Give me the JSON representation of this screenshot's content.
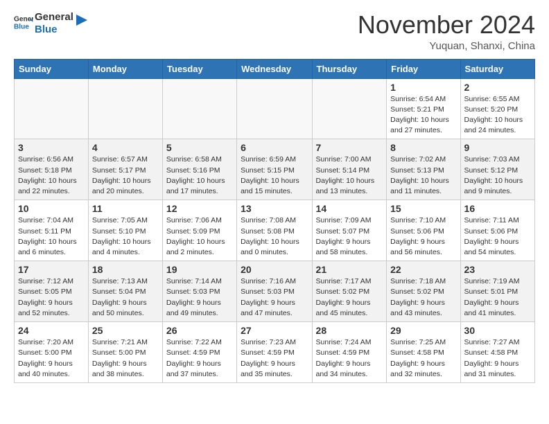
{
  "header": {
    "logo_general": "General",
    "logo_blue": "Blue",
    "month_title": "November 2024",
    "location": "Yuquan, Shanxi, China"
  },
  "weekdays": [
    "Sunday",
    "Monday",
    "Tuesday",
    "Wednesday",
    "Thursday",
    "Friday",
    "Saturday"
  ],
  "weeks": [
    {
      "shaded": false,
      "days": [
        {
          "num": "",
          "info": ""
        },
        {
          "num": "",
          "info": ""
        },
        {
          "num": "",
          "info": ""
        },
        {
          "num": "",
          "info": ""
        },
        {
          "num": "",
          "info": ""
        },
        {
          "num": "1",
          "info": "Sunrise: 6:54 AM\nSunset: 5:21 PM\nDaylight: 10 hours\nand 27 minutes."
        },
        {
          "num": "2",
          "info": "Sunrise: 6:55 AM\nSunset: 5:20 PM\nDaylight: 10 hours\nand 24 minutes."
        }
      ]
    },
    {
      "shaded": true,
      "days": [
        {
          "num": "3",
          "info": "Sunrise: 6:56 AM\nSunset: 5:18 PM\nDaylight: 10 hours\nand 22 minutes."
        },
        {
          "num": "4",
          "info": "Sunrise: 6:57 AM\nSunset: 5:17 PM\nDaylight: 10 hours\nand 20 minutes."
        },
        {
          "num": "5",
          "info": "Sunrise: 6:58 AM\nSunset: 5:16 PM\nDaylight: 10 hours\nand 17 minutes."
        },
        {
          "num": "6",
          "info": "Sunrise: 6:59 AM\nSunset: 5:15 PM\nDaylight: 10 hours\nand 15 minutes."
        },
        {
          "num": "7",
          "info": "Sunrise: 7:00 AM\nSunset: 5:14 PM\nDaylight: 10 hours\nand 13 minutes."
        },
        {
          "num": "8",
          "info": "Sunrise: 7:02 AM\nSunset: 5:13 PM\nDaylight: 10 hours\nand 11 minutes."
        },
        {
          "num": "9",
          "info": "Sunrise: 7:03 AM\nSunset: 5:12 PM\nDaylight: 10 hours\nand 9 minutes."
        }
      ]
    },
    {
      "shaded": false,
      "days": [
        {
          "num": "10",
          "info": "Sunrise: 7:04 AM\nSunset: 5:11 PM\nDaylight: 10 hours\nand 6 minutes."
        },
        {
          "num": "11",
          "info": "Sunrise: 7:05 AM\nSunset: 5:10 PM\nDaylight: 10 hours\nand 4 minutes."
        },
        {
          "num": "12",
          "info": "Sunrise: 7:06 AM\nSunset: 5:09 PM\nDaylight: 10 hours\nand 2 minutes."
        },
        {
          "num": "13",
          "info": "Sunrise: 7:08 AM\nSunset: 5:08 PM\nDaylight: 10 hours\nand 0 minutes."
        },
        {
          "num": "14",
          "info": "Sunrise: 7:09 AM\nSunset: 5:07 PM\nDaylight: 9 hours\nand 58 minutes."
        },
        {
          "num": "15",
          "info": "Sunrise: 7:10 AM\nSunset: 5:06 PM\nDaylight: 9 hours\nand 56 minutes."
        },
        {
          "num": "16",
          "info": "Sunrise: 7:11 AM\nSunset: 5:06 PM\nDaylight: 9 hours\nand 54 minutes."
        }
      ]
    },
    {
      "shaded": true,
      "days": [
        {
          "num": "17",
          "info": "Sunrise: 7:12 AM\nSunset: 5:05 PM\nDaylight: 9 hours\nand 52 minutes."
        },
        {
          "num": "18",
          "info": "Sunrise: 7:13 AM\nSunset: 5:04 PM\nDaylight: 9 hours\nand 50 minutes."
        },
        {
          "num": "19",
          "info": "Sunrise: 7:14 AM\nSunset: 5:03 PM\nDaylight: 9 hours\nand 49 minutes."
        },
        {
          "num": "20",
          "info": "Sunrise: 7:16 AM\nSunset: 5:03 PM\nDaylight: 9 hours\nand 47 minutes."
        },
        {
          "num": "21",
          "info": "Sunrise: 7:17 AM\nSunset: 5:02 PM\nDaylight: 9 hours\nand 45 minutes."
        },
        {
          "num": "22",
          "info": "Sunrise: 7:18 AM\nSunset: 5:02 PM\nDaylight: 9 hours\nand 43 minutes."
        },
        {
          "num": "23",
          "info": "Sunrise: 7:19 AM\nSunset: 5:01 PM\nDaylight: 9 hours\nand 41 minutes."
        }
      ]
    },
    {
      "shaded": false,
      "days": [
        {
          "num": "24",
          "info": "Sunrise: 7:20 AM\nSunset: 5:00 PM\nDaylight: 9 hours\nand 40 minutes."
        },
        {
          "num": "25",
          "info": "Sunrise: 7:21 AM\nSunset: 5:00 PM\nDaylight: 9 hours\nand 38 minutes."
        },
        {
          "num": "26",
          "info": "Sunrise: 7:22 AM\nSunset: 4:59 PM\nDaylight: 9 hours\nand 37 minutes."
        },
        {
          "num": "27",
          "info": "Sunrise: 7:23 AM\nSunset: 4:59 PM\nDaylight: 9 hours\nand 35 minutes."
        },
        {
          "num": "28",
          "info": "Sunrise: 7:24 AM\nSunset: 4:59 PM\nDaylight: 9 hours\nand 34 minutes."
        },
        {
          "num": "29",
          "info": "Sunrise: 7:25 AM\nSunset: 4:58 PM\nDaylight: 9 hours\nand 32 minutes."
        },
        {
          "num": "30",
          "info": "Sunrise: 7:27 AM\nSunset: 4:58 PM\nDaylight: 9 hours\nand 31 minutes."
        }
      ]
    }
  ]
}
